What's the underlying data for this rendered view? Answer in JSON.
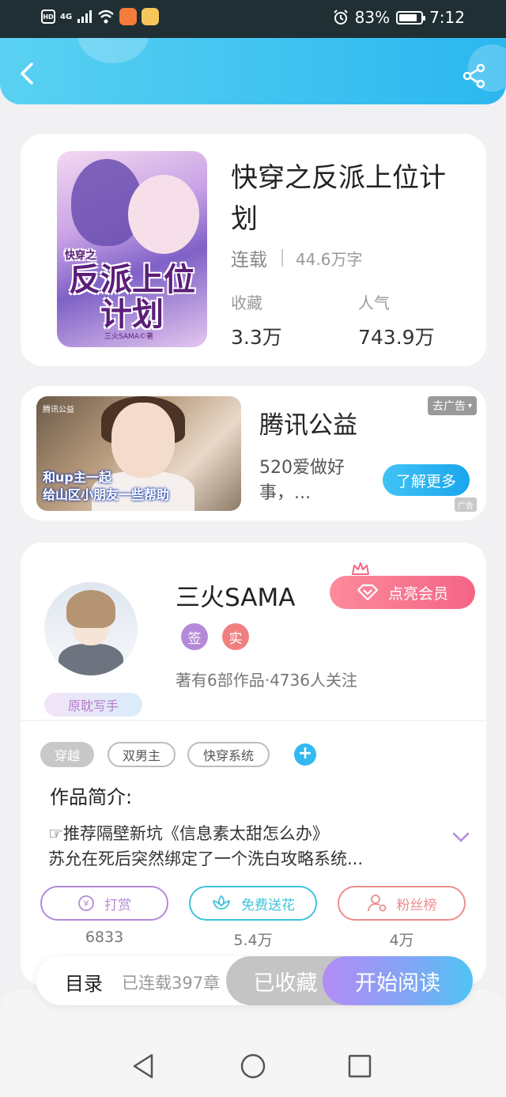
{
  "status_bar": {
    "hd": "HD",
    "network": "4G",
    "battery": "83%",
    "time": "7:12"
  },
  "book": {
    "title": "快穿之反派上位计划",
    "status": "连载",
    "word_count": "44.6万字",
    "collect_label": "收藏",
    "collect_value": "3.3万",
    "popularity_label": "人气",
    "popularity_value": "743.9万",
    "cover_title": "反派上位计划",
    "cover_prefix": "快穿之",
    "cover_author": "三火SAMA©著"
  },
  "ad": {
    "title": "腾讯公益",
    "description": "520爱做好事，...",
    "close_label": "去广告",
    "cta_label": "了解更多",
    "tag_label": "广告",
    "image_logo": "腾讯公益",
    "image_caption_line1": "和up主一起",
    "image_caption_line2": "给山区小朋友一些帮助"
  },
  "author": {
    "name": "三火SAMA",
    "badge_sign": "签",
    "badge_real": "实",
    "works": "著有6部作品·4736人关注",
    "writer_badge": "原耽写手",
    "vip_label": "点亮会员"
  },
  "tags": [
    "穿越",
    "双男主",
    "快穿系统"
  ],
  "intro": {
    "heading": "作品简介:",
    "line1": "☞推荐隔壁新坑《信息素太甜怎么办》",
    "line2": "苏允在死后突然绑定了一个洗白攻略系统..."
  },
  "actions": [
    {
      "label": "打赏",
      "count": "6833",
      "color": "#b48ad8"
    },
    {
      "label": "免费送花",
      "count": "5.4万",
      "color": "#3fc3dc"
    },
    {
      "label": "粉丝榜",
      "count": "4万",
      "color": "#ec8d8d"
    }
  ],
  "bottom_bar": {
    "toc_label": "目录",
    "toc_status": "已连载397章",
    "collected_label": "已收藏",
    "read_label": "开始阅读"
  },
  "colors": {
    "header_start": "#5ad1f2",
    "header_end": "#2bb7ef",
    "vip": "#f46586",
    "badge_sign": "#b48ad8",
    "badge_real": "#f08080"
  }
}
